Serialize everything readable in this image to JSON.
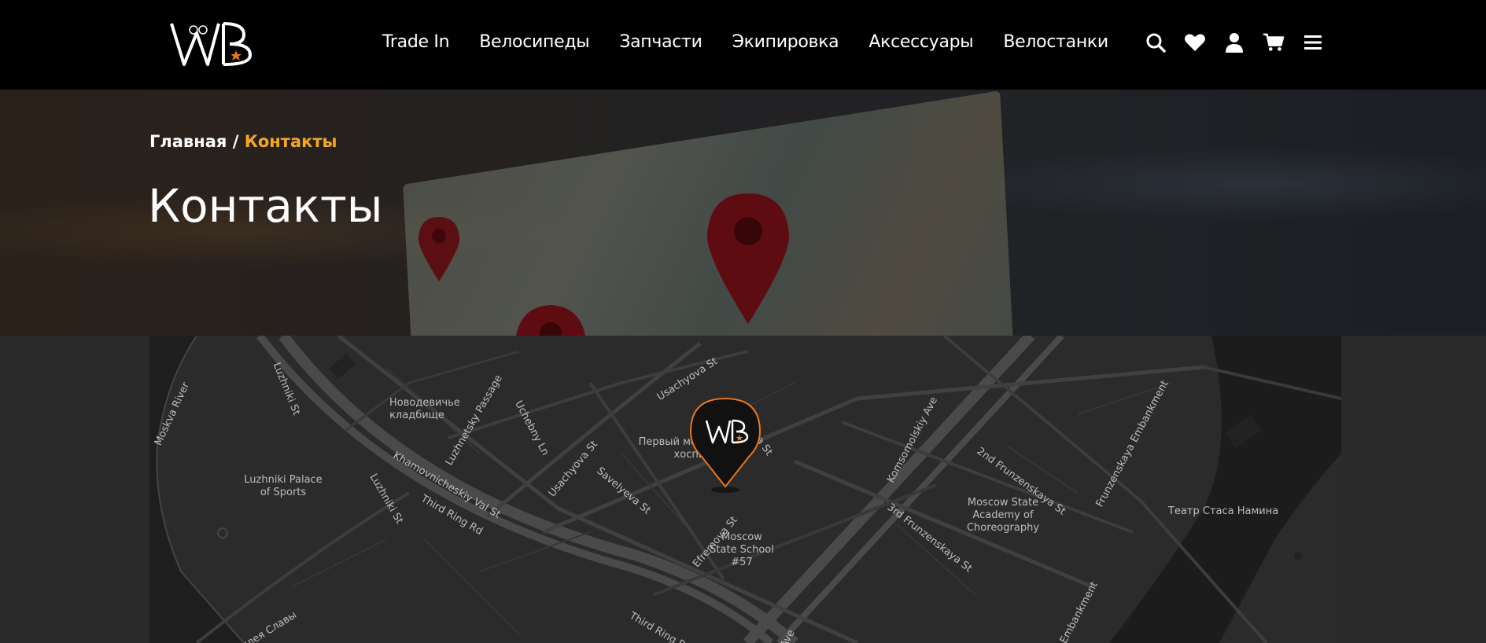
{
  "header": {
    "logo_text": "WB",
    "nav": [
      "Trade In",
      "Велосипеды",
      "Запчасти",
      "Экипировка",
      "Аксессуары",
      "Велостанки"
    ],
    "icons": [
      "search-icon",
      "heart-icon",
      "user-icon",
      "cart-icon",
      "menu-icon"
    ]
  },
  "breadcrumb": {
    "home": "Главная",
    "separator": " / ",
    "current": "Контакты"
  },
  "page_title": "Контакты",
  "colors": {
    "accent": "#f5a623",
    "header_bg": "#000000",
    "map_bg": "#2b2b2b",
    "marker_ring": "#e8761e"
  },
  "map": {
    "labels": [
      "Moskva River",
      "Luzhniki St",
      "Новодевичье кладбище",
      "Luzhnetsky Passage",
      "Uchebny Ln",
      "Usachyova St",
      "Usachyova St",
      "Khamovnicheskiy Val St",
      "Third Ring Rd",
      "Luzhniki Palace of Sports",
      "Luzhniki St",
      "Savelyeva St",
      "Первый московский хоспис",
      "va St",
      "Efremova St",
      "Komsomolskiy Ave",
      "2nd Frunzenskaya St",
      "Frunzenskaya Embankment",
      "Moscow State Academy of Choreography",
      "3rd Frunzenskaya St",
      "Moscow State School #57",
      "Театр Стаса Намина",
      "аллея Славы",
      "Third Ring Rd",
      "Ave",
      "a Embankment"
    ]
  }
}
